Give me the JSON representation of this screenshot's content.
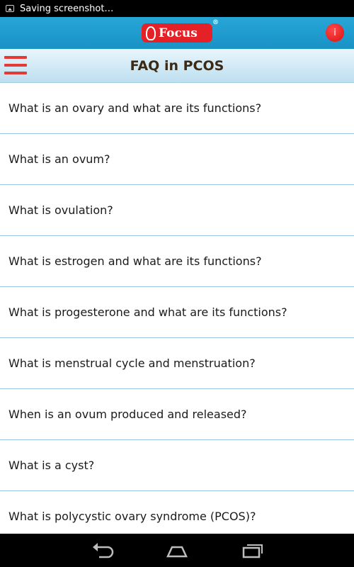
{
  "status_bar": {
    "notification_text": "Saving screenshot…",
    "icon": "screenshot-icon"
  },
  "header": {
    "logo_text": "Focus",
    "logo_mark": "®",
    "info_button_label": "i",
    "brand_color": "#e42127",
    "header_color": "#1f9bd0"
  },
  "title_bar": {
    "title": "FAQ in PCOS",
    "menu_icon": "hamburger-menu-icon",
    "menu_color": "#e53935"
  },
  "faq": {
    "items": [
      "What is an ovary and what are its functions?",
      "What is an ovum?",
      "What is ovulation?",
      "What is estrogen and what are its functions?",
      "What is progesterone and what are its functions?",
      "What is menstrual cycle and menstruation?",
      "When is an ovum produced and released?",
      "What is a cyst?",
      "What is polycystic ovary syndrome (PCOS)?"
    ]
  },
  "nav_bar": {
    "buttons": [
      "back-icon",
      "home-icon",
      "recent-apps-icon"
    ]
  }
}
